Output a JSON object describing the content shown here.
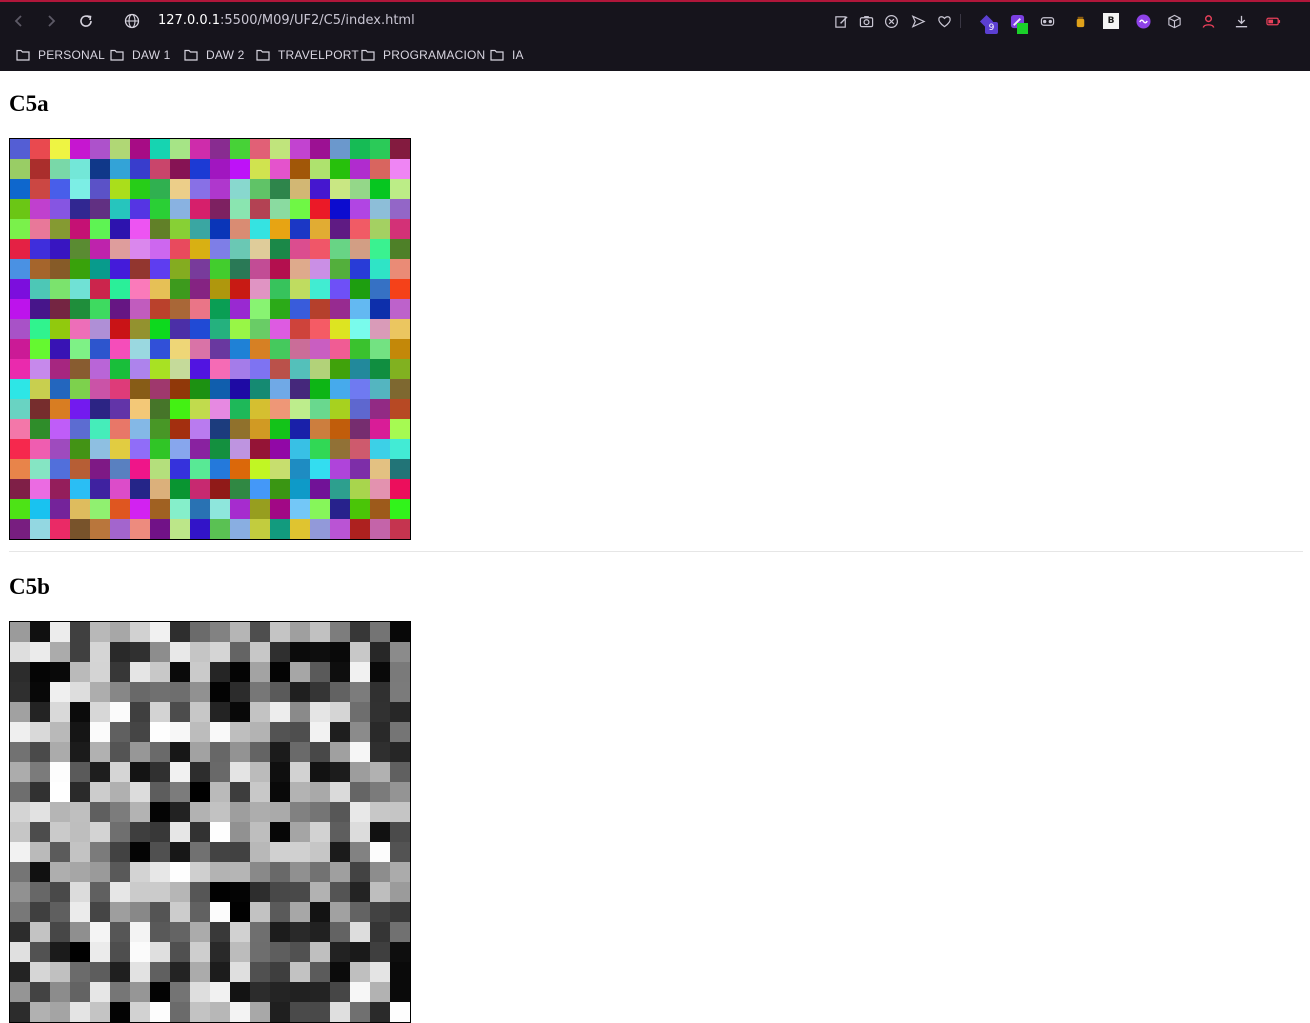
{
  "browser": {
    "url_host": "127.0.0.1",
    "url_path": ":5500/M09/UF2/C5/index.html",
    "badge_count": "9",
    "ext_b_label": "B"
  },
  "bookmarks": [
    {
      "label": "PERSONAL"
    },
    {
      "label": "DAW 1"
    },
    {
      "label": "DAW 2"
    },
    {
      "label": "TRAVELPORT"
    },
    {
      "label": "PROGRAMACION"
    },
    {
      "label": "IA"
    }
  ],
  "sections": {
    "c5a_title": "C5a",
    "c5b_title": "C5b"
  },
  "colors": {
    "chrome_bg": "#16141c",
    "accent_red": "#b0163a"
  },
  "c5a": {
    "rows": 20,
    "cols": 20
  },
  "c5b": {
    "rows": 20,
    "cols": 20
  }
}
